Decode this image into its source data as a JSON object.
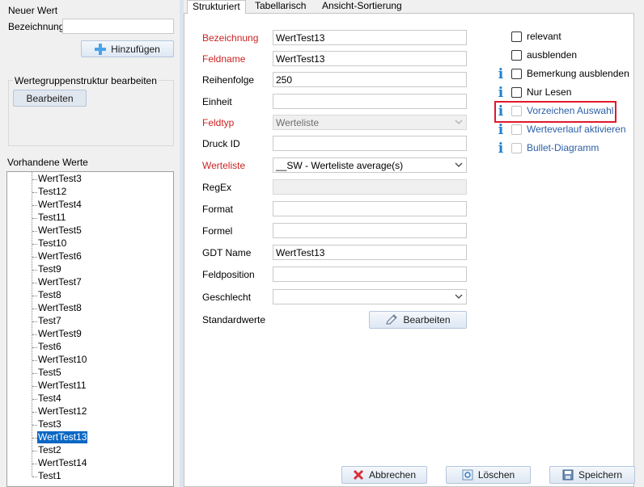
{
  "left": {
    "new_value_title": "Neuer Wert",
    "designation_label": "Bezeichnung",
    "designation_value": "",
    "add_button": "Hinzufügen",
    "group_title": "Wertegruppenstruktur bearbeiten",
    "edit_button": "Bearbeiten",
    "existing_title": "Vorhandene Werte",
    "tree_items": [
      "WertTest3",
      "Test12",
      "WertTest4",
      "Test11",
      "WertTest5",
      "Test10",
      "WertTest6",
      "Test9",
      "WertTest7",
      "Test8",
      "WertTest8",
      "Test7",
      "WertTest9",
      "Test6",
      "WertTest10",
      "Test5",
      "WertTest11",
      "Test4",
      "WertTest12",
      "Test3",
      "WertTest13",
      "Test2",
      "WertTest14",
      "Test1"
    ],
    "selected_item": "WertTest13"
  },
  "tabs": [
    "Strukturiert",
    "Tabellarisch",
    "Ansicht-Sortierung"
  ],
  "active_tab": "Strukturiert",
  "form": {
    "bezeichnung_label": "Bezeichnung",
    "bezeichnung_value": "WertTest13",
    "feldname_label": "Feldname",
    "feldname_value": "WertTest13",
    "reihenfolge_label": "Reihenfolge",
    "reihenfolge_value": "250",
    "einheit_label": "Einheit",
    "einheit_value": "",
    "feldtyp_label": "Feldtyp",
    "feldtyp_value": "Werteliste",
    "druckid_label": "Druck ID",
    "druckid_value": "",
    "werteliste_label": "Werteliste",
    "werteliste_value": "__SW - Werteliste average(s)",
    "regex_label": "RegEx",
    "regex_value": "",
    "format_label": "Format",
    "format_value": "",
    "formel_label": "Formel",
    "formel_value": "",
    "gdt_label": "GDT Name",
    "gdt_value": "WertTest13",
    "feldposition_label": "Feldposition",
    "feldposition_value": "",
    "geschlecht_label": "Geschlecht",
    "geschlecht_value": "",
    "standardwerte_label": "Standardwerte",
    "standardwerte_button": "Bearbeiten"
  },
  "checkboxes": [
    {
      "label": "relevant",
      "checked": false,
      "enabled": true,
      "info": false
    },
    {
      "label": "ausblenden",
      "checked": false,
      "enabled": true,
      "info": false
    },
    {
      "label": "Bemerkung ausblenden",
      "checked": false,
      "enabled": true,
      "info": true
    },
    {
      "label": "Nur Lesen",
      "checked": false,
      "enabled": true,
      "info": true
    },
    {
      "label": "Vorzeichen Auswahl",
      "checked": false,
      "enabled": false,
      "info": true
    },
    {
      "label": "Werteverlauf aktivieren",
      "checked": false,
      "enabled": false,
      "info": true
    },
    {
      "label": "Bullet-Diagramm",
      "checked": false,
      "enabled": false,
      "info": true
    }
  ],
  "footer": {
    "cancel": "Abbrechen",
    "delete": "Löschen",
    "save": "Speichern"
  },
  "colors": {
    "required_label": "#cc2222",
    "selection": "#0b67c3",
    "info_icon": "#1e7fd0",
    "highlight_box": "#e0192b"
  }
}
